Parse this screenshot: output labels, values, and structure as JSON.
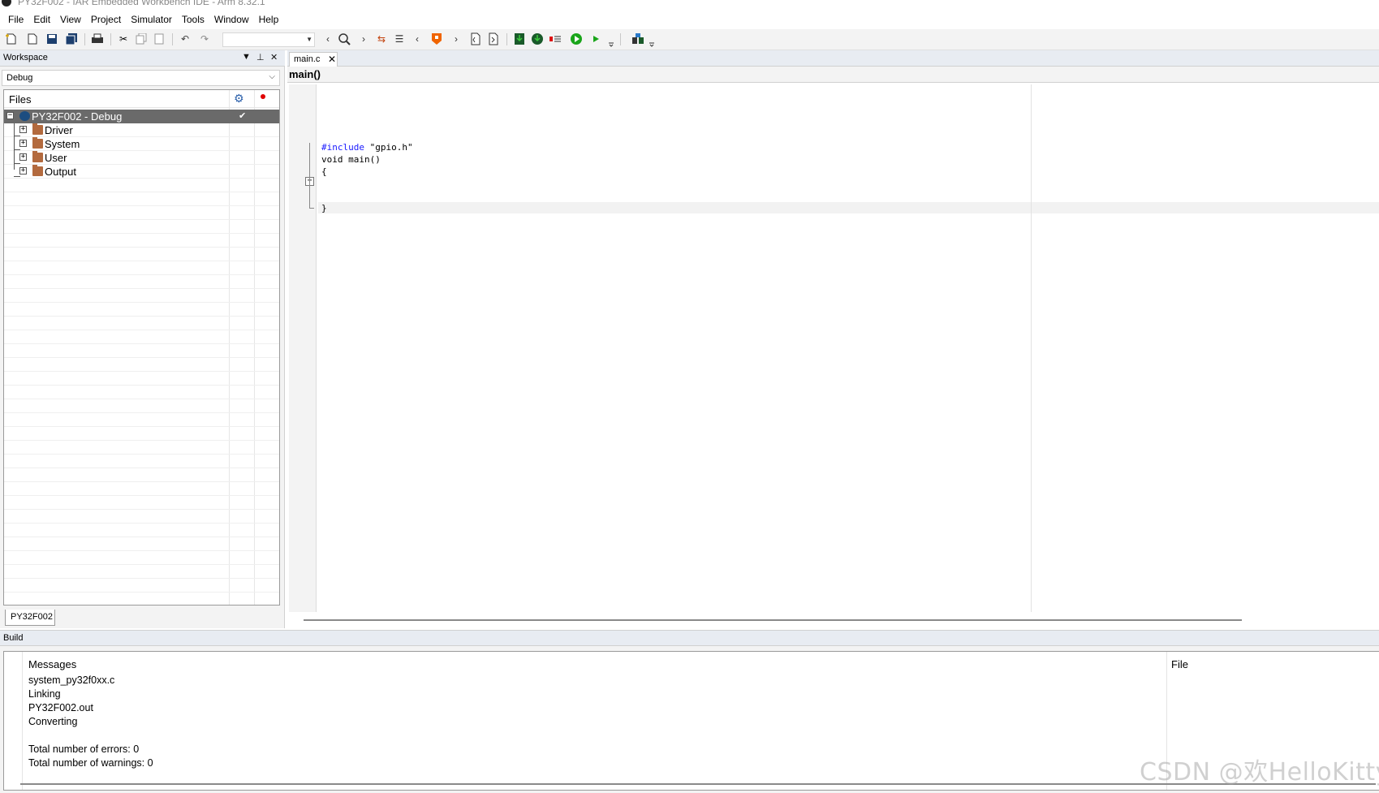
{
  "window": {
    "title": "PY32F002 - IAR Embedded Workbench IDE - Arm 8.32.1"
  },
  "menu": [
    "File",
    "Edit",
    "View",
    "Project",
    "Simulator",
    "Tools",
    "Window",
    "Help"
  ],
  "toolbar": {
    "search_value": ""
  },
  "workspace": {
    "title": "Workspace",
    "configuration": "Debug",
    "files_header": "Files",
    "tree": [
      {
        "label": "PY32F002 - Debug",
        "type": "project",
        "selected": true,
        "checked": true
      },
      {
        "label": "Driver",
        "type": "folder"
      },
      {
        "label": "System",
        "type": "folder"
      },
      {
        "label": "User",
        "type": "folder"
      },
      {
        "label": "Output",
        "type": "folder"
      }
    ],
    "bottom_tab": "PY32F002"
  },
  "editor": {
    "tab_label": "main.c",
    "function_label": "main()",
    "code": {
      "line1_kw": "#include",
      "line1_rest": " \"gpio.h\"",
      "line2": "void main()",
      "line3": "{",
      "line4": "}"
    }
  },
  "build": {
    "title": "Build",
    "col_messages": "Messages",
    "col_file": "File",
    "messages": [
      "system_py32f0xx.c",
      "Linking",
      "PY32F002.out",
      "Converting",
      "",
      "Total number of errors: 0",
      "Total number of warnings: 0"
    ]
  },
  "watermark": "CSDN @欢HelloKitty",
  "colors": {
    "selected_row": "#6a6a6a",
    "keyword": "#1a1aff",
    "folder": "#b36a3e",
    "run_green": "#1aa51a",
    "debug_dot_red": "#e00000"
  }
}
